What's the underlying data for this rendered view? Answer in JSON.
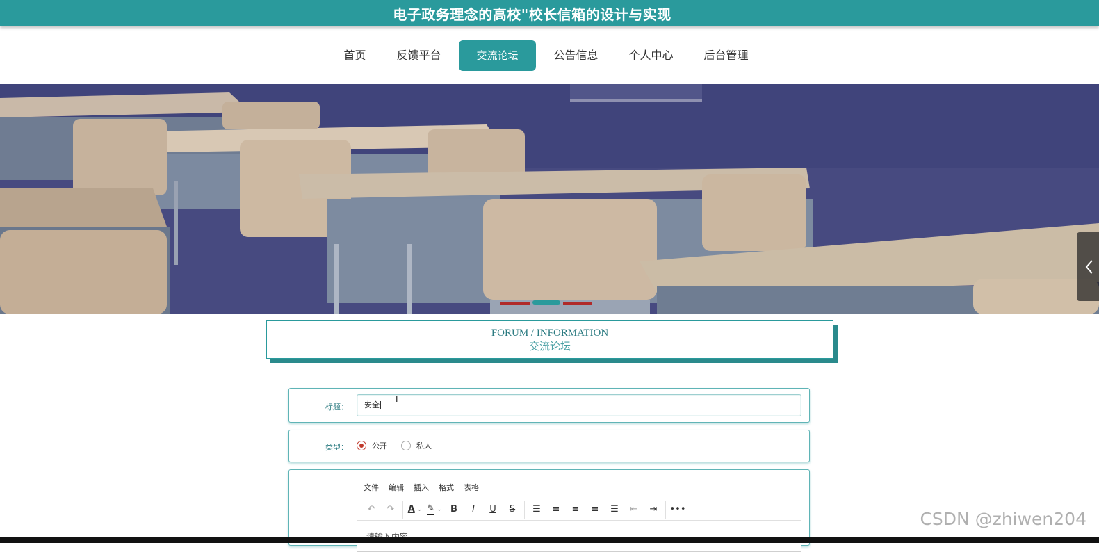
{
  "header": {
    "title": "电子政务理念的高校\"校长信箱的设计与实现"
  },
  "nav": {
    "items": [
      {
        "label": "首页",
        "active": false
      },
      {
        "label": "反馈平台",
        "active": false
      },
      {
        "label": "交流论坛",
        "active": true
      },
      {
        "label": "公告信息",
        "active": false
      },
      {
        "label": "个人中心",
        "active": false
      },
      {
        "label": "后台管理",
        "active": false
      }
    ]
  },
  "section": {
    "en": "FORUM / INFORMATION",
    "cn": "交流论坛"
  },
  "form": {
    "title_label": "标题：",
    "title_value": "安全",
    "type_label": "类型：",
    "type_options": [
      {
        "label": "公开",
        "checked": true
      },
      {
        "label": "私人",
        "checked": false
      }
    ]
  },
  "editor": {
    "menu": [
      "文件",
      "编辑",
      "插入",
      "格式",
      "表格"
    ],
    "placeholder": "请输入内容",
    "toolbar_icons": [
      "undo-icon",
      "redo-icon",
      "font-color-icon",
      "highlight-icon",
      "bold-icon",
      "italic-icon",
      "underline-icon",
      "strikethrough-icon",
      "line-height-icon",
      "align-left-icon",
      "align-center-icon",
      "align-right-icon",
      "justify-icon",
      "outdent-icon",
      "indent-icon",
      "more-icon"
    ]
  },
  "watermark": "CSDN @zhiwen204",
  "colors": {
    "primary": "#2a9a9c",
    "radio_checked": "#c0392b"
  }
}
